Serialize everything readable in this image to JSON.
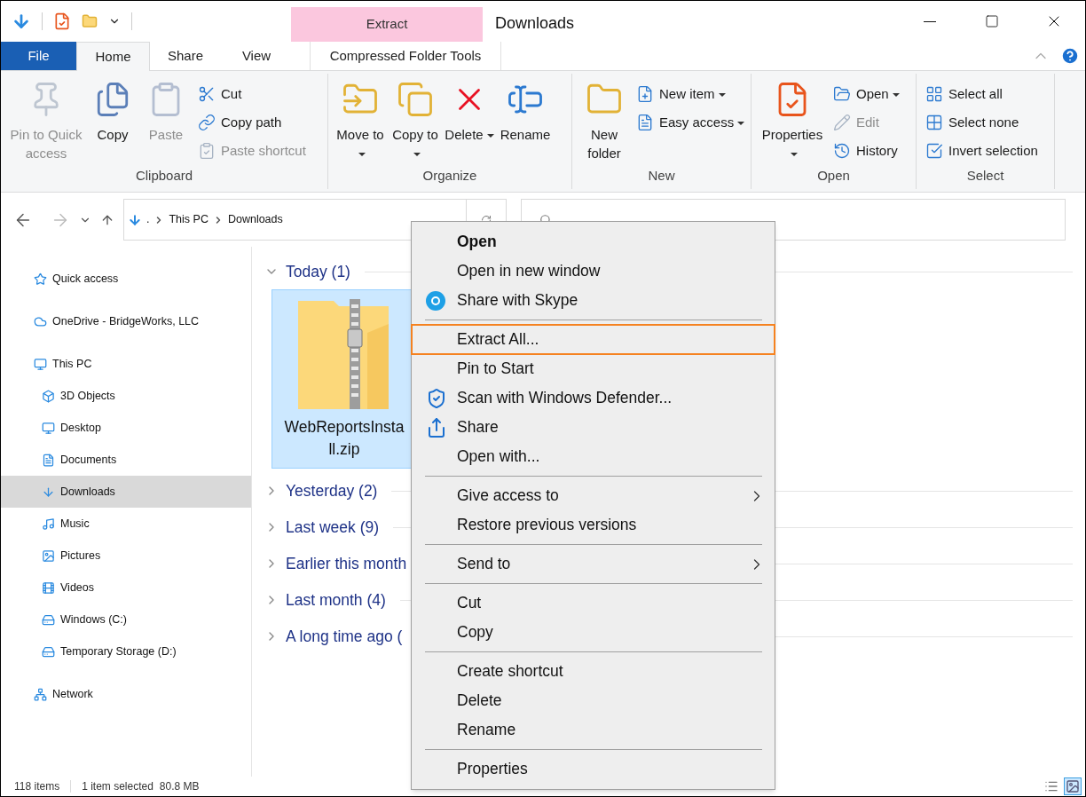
{
  "window": {
    "title": "Downloads",
    "contextual_tab": "Extract"
  },
  "tabs": [
    {
      "label": "File",
      "kind": "file",
      "selected": false
    },
    {
      "label": "Home",
      "kind": "tab",
      "selected": true
    },
    {
      "label": "Share",
      "kind": "tab",
      "selected": false
    },
    {
      "label": "View",
      "kind": "tab",
      "selected": false
    },
    {
      "label": "Compressed Folder Tools",
      "kind": "context",
      "selected": false
    }
  ],
  "ribbon": {
    "groups": [
      {
        "label": "Clipboard",
        "items": [
          {
            "label": "Pin to Quick access",
            "kind": "large",
            "disabled": true,
            "dropdown": false
          },
          {
            "label": "Copy",
            "kind": "large",
            "disabled": false,
            "dropdown": false
          },
          {
            "label": "Paste",
            "kind": "large",
            "disabled": true,
            "dropdown": false
          },
          {
            "label": "Cut",
            "kind": "small",
            "disabled": false,
            "dropdown": false
          },
          {
            "label": "Copy path",
            "kind": "small",
            "disabled": false,
            "dropdown": false
          },
          {
            "label": "Paste shortcut",
            "kind": "small",
            "disabled": true,
            "dropdown": false
          }
        ]
      },
      {
        "label": "Organize",
        "items": [
          {
            "label": "Move to",
            "kind": "large",
            "disabled": false,
            "dropdown": true
          },
          {
            "label": "Copy to",
            "kind": "large",
            "disabled": false,
            "dropdown": true
          },
          {
            "label": "Delete",
            "kind": "large",
            "disabled": false,
            "dropdown": true
          },
          {
            "label": "Rename",
            "kind": "large",
            "disabled": false,
            "dropdown": false
          }
        ]
      },
      {
        "label": "New",
        "items": [
          {
            "label": "New folder",
            "kind": "large",
            "disabled": false,
            "dropdown": false
          },
          {
            "label": "New item",
            "kind": "small",
            "disabled": false,
            "dropdown": true
          },
          {
            "label": "Easy access",
            "kind": "small",
            "disabled": false,
            "dropdown": true
          }
        ]
      },
      {
        "label": "Open",
        "items": [
          {
            "label": "Properties",
            "kind": "large",
            "disabled": false,
            "dropdown": true
          },
          {
            "label": "Open",
            "kind": "small",
            "disabled": false,
            "dropdown": true
          },
          {
            "label": "Edit",
            "kind": "small",
            "disabled": true,
            "dropdown": false
          },
          {
            "label": "History",
            "kind": "small",
            "disabled": false,
            "dropdown": false
          }
        ]
      },
      {
        "label": "Select",
        "items": [
          {
            "label": "Select all",
            "kind": "small",
            "disabled": false,
            "dropdown": false
          },
          {
            "label": "Select none",
            "kind": "small",
            "disabled": false,
            "dropdown": false
          },
          {
            "label": "Invert selection",
            "kind": "small",
            "disabled": false,
            "dropdown": false
          }
        ]
      }
    ]
  },
  "address": {
    "crumbs": [
      ".",
      "This PC",
      "Downloads"
    ]
  },
  "sidebar": {
    "items": [
      {
        "label": "Quick access",
        "selected": false
      },
      {
        "label": "OneDrive - BridgeWorks, LLC",
        "selected": false
      },
      {
        "label": "This PC",
        "selected": false,
        "children": [
          {
            "label": "3D Objects",
            "selected": false
          },
          {
            "label": "Desktop",
            "selected": false
          },
          {
            "label": "Documents",
            "selected": false
          },
          {
            "label": "Downloads",
            "selected": true
          },
          {
            "label": "Music",
            "selected": false
          },
          {
            "label": "Pictures",
            "selected": false
          },
          {
            "label": "Videos",
            "selected": false
          },
          {
            "label": "Windows (C:)",
            "selected": false
          },
          {
            "label": "Temporary Storage (D:)",
            "selected": false
          }
        ]
      },
      {
        "label": "Network",
        "selected": false
      }
    ]
  },
  "groups": [
    {
      "label": "Today (1)",
      "expanded": true,
      "files": [
        {
          "name": "WebReportsInstall.zip",
          "selected": true
        }
      ]
    },
    {
      "label": "Yesterday (2)",
      "expanded": false
    },
    {
      "label": "Last week (9)",
      "expanded": false
    },
    {
      "label": "Earlier this month",
      "expanded": false
    },
    {
      "label": "Last month (4)",
      "expanded": false
    },
    {
      "label": "A long time ago (",
      "expanded": false
    }
  ],
  "context_menu": {
    "sections": [
      [
        {
          "label": "Open",
          "bold": true,
          "submenu": false,
          "highlighted": false
        },
        {
          "label": "Open in new window",
          "bold": false,
          "submenu": false,
          "highlighted": false
        },
        {
          "label": "Share with Skype",
          "bold": false,
          "submenu": false,
          "highlighted": false
        }
      ],
      [
        {
          "label": "Extract All...",
          "bold": false,
          "submenu": false,
          "highlighted": true
        },
        {
          "label": "Pin to Start",
          "bold": false,
          "submenu": false,
          "highlighted": false
        },
        {
          "label": "Scan with Windows Defender...",
          "bold": false,
          "submenu": false,
          "highlighted": false
        },
        {
          "label": "Share",
          "bold": false,
          "submenu": false,
          "highlighted": false
        },
        {
          "label": "Open with...",
          "bold": false,
          "submenu": false,
          "highlighted": false
        }
      ],
      [
        {
          "label": "Give access to",
          "bold": false,
          "submenu": true,
          "highlighted": false
        },
        {
          "label": "Restore previous versions",
          "bold": false,
          "submenu": false,
          "highlighted": false
        }
      ],
      [
        {
          "label": "Send to",
          "bold": false,
          "submenu": true,
          "highlighted": false
        }
      ],
      [
        {
          "label": "Cut",
          "bold": false,
          "submenu": false,
          "highlighted": false
        },
        {
          "label": "Copy",
          "bold": false,
          "submenu": false,
          "highlighted": false
        }
      ],
      [
        {
          "label": "Create shortcut",
          "bold": false,
          "submenu": false,
          "highlighted": false
        },
        {
          "label": "Delete",
          "bold": false,
          "submenu": false,
          "highlighted": false
        },
        {
          "label": "Rename",
          "bold": false,
          "submenu": false,
          "highlighted": false
        }
      ],
      [
        {
          "label": "Properties",
          "bold": false,
          "submenu": false,
          "highlighted": false
        }
      ]
    ]
  },
  "status_bar": {
    "item_count": "118 items",
    "selection": "1 item selected",
    "size": "80.8 MB"
  },
  "views": [
    {
      "selected": false
    },
    {
      "selected": true
    }
  ]
}
